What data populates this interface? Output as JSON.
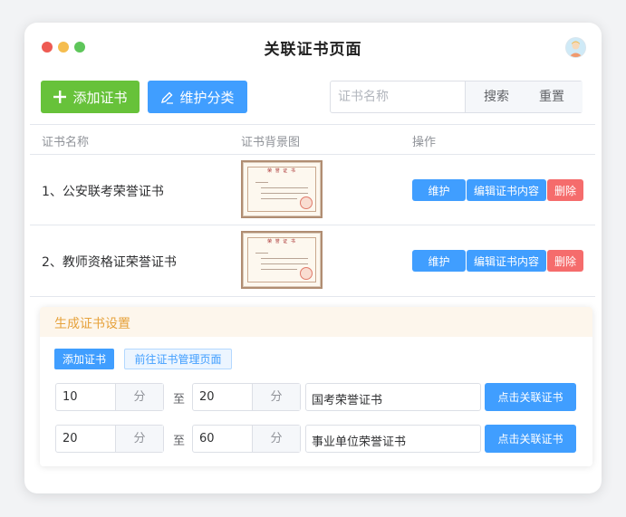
{
  "window": {
    "title": "关联证书页面",
    "traffic_colors": [
      "#ee5a52",
      "#f5bd4f",
      "#5ec65a"
    ]
  },
  "toolbar": {
    "add_label": "添加证书",
    "maintain_category_label": "维护分类",
    "search_placeholder": "证书名称",
    "search_label": "搜索",
    "reset_label": "重置"
  },
  "table": {
    "headers": [
      "证书名称",
      "证书背景图",
      "操作"
    ],
    "rows": [
      {
        "name": "1、公安联考荣誉证书",
        "maintain": "维护",
        "edit": "编辑证书内容",
        "delete": "删除"
      },
      {
        "name": "2、教师资格证荣誉证书",
        "maintain": "维护",
        "edit": "编辑证书内容",
        "delete": "删除"
      }
    ],
    "cert_thumb": {
      "heading": "荣 誉 证 书"
    }
  },
  "settings": {
    "title": "生成证书设置",
    "add_label": "添加证书",
    "goto_label": "前往证书管理页面",
    "rules": [
      {
        "from": "10",
        "to": "20",
        "unit": "分",
        "sep": "至",
        "cert": "国考荣誉证书",
        "link_label": "点击关联证书"
      },
      {
        "from": "20",
        "to": "60",
        "unit": "分",
        "sep": "至",
        "cert": "事业单位荣誉证书",
        "link_label": "点击关联证书"
      }
    ]
  },
  "colors": {
    "primary": "#409eff",
    "success": "#67c23a",
    "danger": "#f56c6c",
    "warning": "#e6a23c"
  }
}
